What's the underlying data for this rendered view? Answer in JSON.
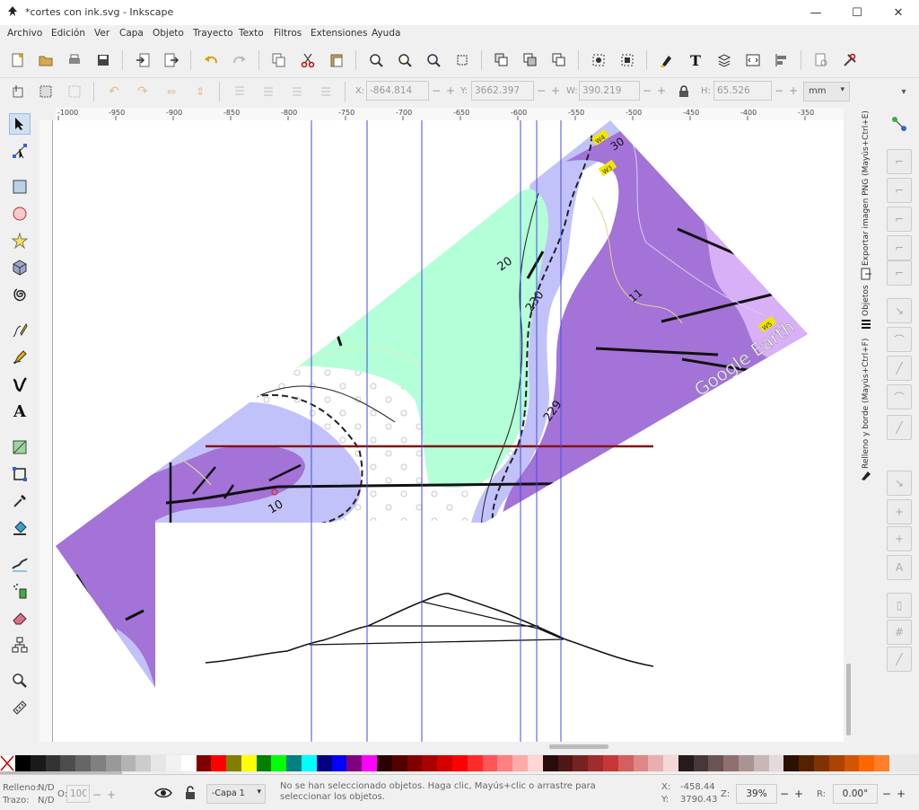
{
  "window": {
    "title": "*cortes con ink.svg - Inkscape",
    "minimize": "—",
    "maximize": "☐",
    "close": "✕"
  },
  "menu": [
    "Archivo",
    "Edición",
    "Ver",
    "Capa",
    "Objeto",
    "Trayecto",
    "Texto",
    "Filtros",
    "Extensiones",
    "Ayuda"
  ],
  "controls": {
    "x_label": "X:",
    "x_value": "-864.814",
    "y_label": "Y:",
    "y_value": "3662.397",
    "w_label": "W:",
    "w_value": "390.219",
    "h_label": "H:",
    "h_value": "65.526",
    "unit": "mm",
    "lock_icon": "padlock-icon"
  },
  "ruler": {
    "ticks": [
      "-1000",
      "-950",
      "-900",
      "-850",
      "-800",
      "-750",
      "-700",
      "-650",
      "-600",
      "-550",
      "-500",
      "-450",
      "-400",
      "-350"
    ]
  },
  "map": {
    "labels": [
      "20",
      "230",
      "229",
      "10",
      "11",
      "30"
    ],
    "watermark": "Google Earth",
    "badges": [
      "W4",
      "W3",
      "W5"
    ]
  },
  "dock": {
    "panel1": "Exportar imagen PNG (Mayús+Ctrl+E)",
    "panel2": "Objetos",
    "panel3": "Relleno y borde (Mayús+Ctrl+F)"
  },
  "palette": [
    "#000000",
    "#1a1a1a",
    "#333333",
    "#4d4d4d",
    "#666666",
    "#808080",
    "#999999",
    "#b3b3b3",
    "#cccccc",
    "#e6e6e6",
    "#f2f2f2",
    "#ffffff",
    "#800000",
    "#ff0000",
    "#808000",
    "#ffff00",
    "#008000",
    "#00ff00",
    "#008080",
    "#00ffff",
    "#000080",
    "#0000ff",
    "#800080",
    "#ff00ff",
    "#2b0000",
    "#550000",
    "#800000",
    "#aa0000",
    "#d40000",
    "#ff0000",
    "#ff2a2a",
    "#ff5555",
    "#ff8080",
    "#ffaaaa",
    "#ffd5d5",
    "#280b0b",
    "#501616",
    "#782121",
    "#a02c2c",
    "#c83737",
    "#d35f5f",
    "#de8787",
    "#e9afaf",
    "#f4d7d7",
    "#241c1c",
    "#483737",
    "#6c5353",
    "#916f6f",
    "#ac9393",
    "#c8b7b7",
    "#e3dbdb",
    "#2b1100",
    "#552200",
    "#803300",
    "#aa4400",
    "#d45500",
    "#ff6600",
    "#ff7f2a"
  ],
  "status": {
    "fill_label": "Relleno:",
    "fill_value": "N/D",
    "stroke_label": "Trazo:",
    "stroke_value": "N/D",
    "opacity_label": "O:",
    "opacity_value": "100",
    "layer": "-Capa 1",
    "message": "No se han seleccionado objetos. Haga clic, Mayús+clic o arrastre para seleccionar los objetos.",
    "x_label": "X:",
    "x_value": "-458.44",
    "y_label": "Y:",
    "y_value": "3790.43",
    "zoom_label": "Z:",
    "zoom_value": "39%",
    "rot_label": "R:",
    "rot_value": "0.00°"
  }
}
